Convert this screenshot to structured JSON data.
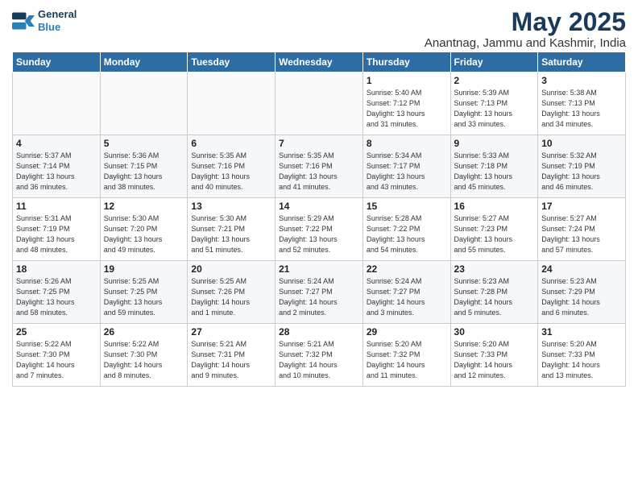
{
  "logo": {
    "line1": "General",
    "line2": "Blue"
  },
  "title": "May 2025",
  "subtitle": "Anantnag, Jammu and Kashmir, India",
  "headers": [
    "Sunday",
    "Monday",
    "Tuesday",
    "Wednesday",
    "Thursday",
    "Friday",
    "Saturday"
  ],
  "weeks": [
    [
      {
        "day": "",
        "info": ""
      },
      {
        "day": "",
        "info": ""
      },
      {
        "day": "",
        "info": ""
      },
      {
        "day": "",
        "info": ""
      },
      {
        "day": "1",
        "info": "Sunrise: 5:40 AM\nSunset: 7:12 PM\nDaylight: 13 hours\nand 31 minutes."
      },
      {
        "day": "2",
        "info": "Sunrise: 5:39 AM\nSunset: 7:13 PM\nDaylight: 13 hours\nand 33 minutes."
      },
      {
        "day": "3",
        "info": "Sunrise: 5:38 AM\nSunset: 7:13 PM\nDaylight: 13 hours\nand 34 minutes."
      }
    ],
    [
      {
        "day": "4",
        "info": "Sunrise: 5:37 AM\nSunset: 7:14 PM\nDaylight: 13 hours\nand 36 minutes."
      },
      {
        "day": "5",
        "info": "Sunrise: 5:36 AM\nSunset: 7:15 PM\nDaylight: 13 hours\nand 38 minutes."
      },
      {
        "day": "6",
        "info": "Sunrise: 5:35 AM\nSunset: 7:16 PM\nDaylight: 13 hours\nand 40 minutes."
      },
      {
        "day": "7",
        "info": "Sunrise: 5:35 AM\nSunset: 7:16 PM\nDaylight: 13 hours\nand 41 minutes."
      },
      {
        "day": "8",
        "info": "Sunrise: 5:34 AM\nSunset: 7:17 PM\nDaylight: 13 hours\nand 43 minutes."
      },
      {
        "day": "9",
        "info": "Sunrise: 5:33 AM\nSunset: 7:18 PM\nDaylight: 13 hours\nand 45 minutes."
      },
      {
        "day": "10",
        "info": "Sunrise: 5:32 AM\nSunset: 7:19 PM\nDaylight: 13 hours\nand 46 minutes."
      }
    ],
    [
      {
        "day": "11",
        "info": "Sunrise: 5:31 AM\nSunset: 7:19 PM\nDaylight: 13 hours\nand 48 minutes."
      },
      {
        "day": "12",
        "info": "Sunrise: 5:30 AM\nSunset: 7:20 PM\nDaylight: 13 hours\nand 49 minutes."
      },
      {
        "day": "13",
        "info": "Sunrise: 5:30 AM\nSunset: 7:21 PM\nDaylight: 13 hours\nand 51 minutes."
      },
      {
        "day": "14",
        "info": "Sunrise: 5:29 AM\nSunset: 7:22 PM\nDaylight: 13 hours\nand 52 minutes."
      },
      {
        "day": "15",
        "info": "Sunrise: 5:28 AM\nSunset: 7:22 PM\nDaylight: 13 hours\nand 54 minutes."
      },
      {
        "day": "16",
        "info": "Sunrise: 5:27 AM\nSunset: 7:23 PM\nDaylight: 13 hours\nand 55 minutes."
      },
      {
        "day": "17",
        "info": "Sunrise: 5:27 AM\nSunset: 7:24 PM\nDaylight: 13 hours\nand 57 minutes."
      }
    ],
    [
      {
        "day": "18",
        "info": "Sunrise: 5:26 AM\nSunset: 7:25 PM\nDaylight: 13 hours\nand 58 minutes."
      },
      {
        "day": "19",
        "info": "Sunrise: 5:25 AM\nSunset: 7:25 PM\nDaylight: 13 hours\nand 59 minutes."
      },
      {
        "day": "20",
        "info": "Sunrise: 5:25 AM\nSunset: 7:26 PM\nDaylight: 14 hours\nand 1 minute."
      },
      {
        "day": "21",
        "info": "Sunrise: 5:24 AM\nSunset: 7:27 PM\nDaylight: 14 hours\nand 2 minutes."
      },
      {
        "day": "22",
        "info": "Sunrise: 5:24 AM\nSunset: 7:27 PM\nDaylight: 14 hours\nand 3 minutes."
      },
      {
        "day": "23",
        "info": "Sunrise: 5:23 AM\nSunset: 7:28 PM\nDaylight: 14 hours\nand 5 minutes."
      },
      {
        "day": "24",
        "info": "Sunrise: 5:23 AM\nSunset: 7:29 PM\nDaylight: 14 hours\nand 6 minutes."
      }
    ],
    [
      {
        "day": "25",
        "info": "Sunrise: 5:22 AM\nSunset: 7:30 PM\nDaylight: 14 hours\nand 7 minutes."
      },
      {
        "day": "26",
        "info": "Sunrise: 5:22 AM\nSunset: 7:30 PM\nDaylight: 14 hours\nand 8 minutes."
      },
      {
        "day": "27",
        "info": "Sunrise: 5:21 AM\nSunset: 7:31 PM\nDaylight: 14 hours\nand 9 minutes."
      },
      {
        "day": "28",
        "info": "Sunrise: 5:21 AM\nSunset: 7:32 PM\nDaylight: 14 hours\nand 10 minutes."
      },
      {
        "day": "29",
        "info": "Sunrise: 5:20 AM\nSunset: 7:32 PM\nDaylight: 14 hours\nand 11 minutes."
      },
      {
        "day": "30",
        "info": "Sunrise: 5:20 AM\nSunset: 7:33 PM\nDaylight: 14 hours\nand 12 minutes."
      },
      {
        "day": "31",
        "info": "Sunrise: 5:20 AM\nSunset: 7:33 PM\nDaylight: 14 hours\nand 13 minutes."
      }
    ]
  ]
}
